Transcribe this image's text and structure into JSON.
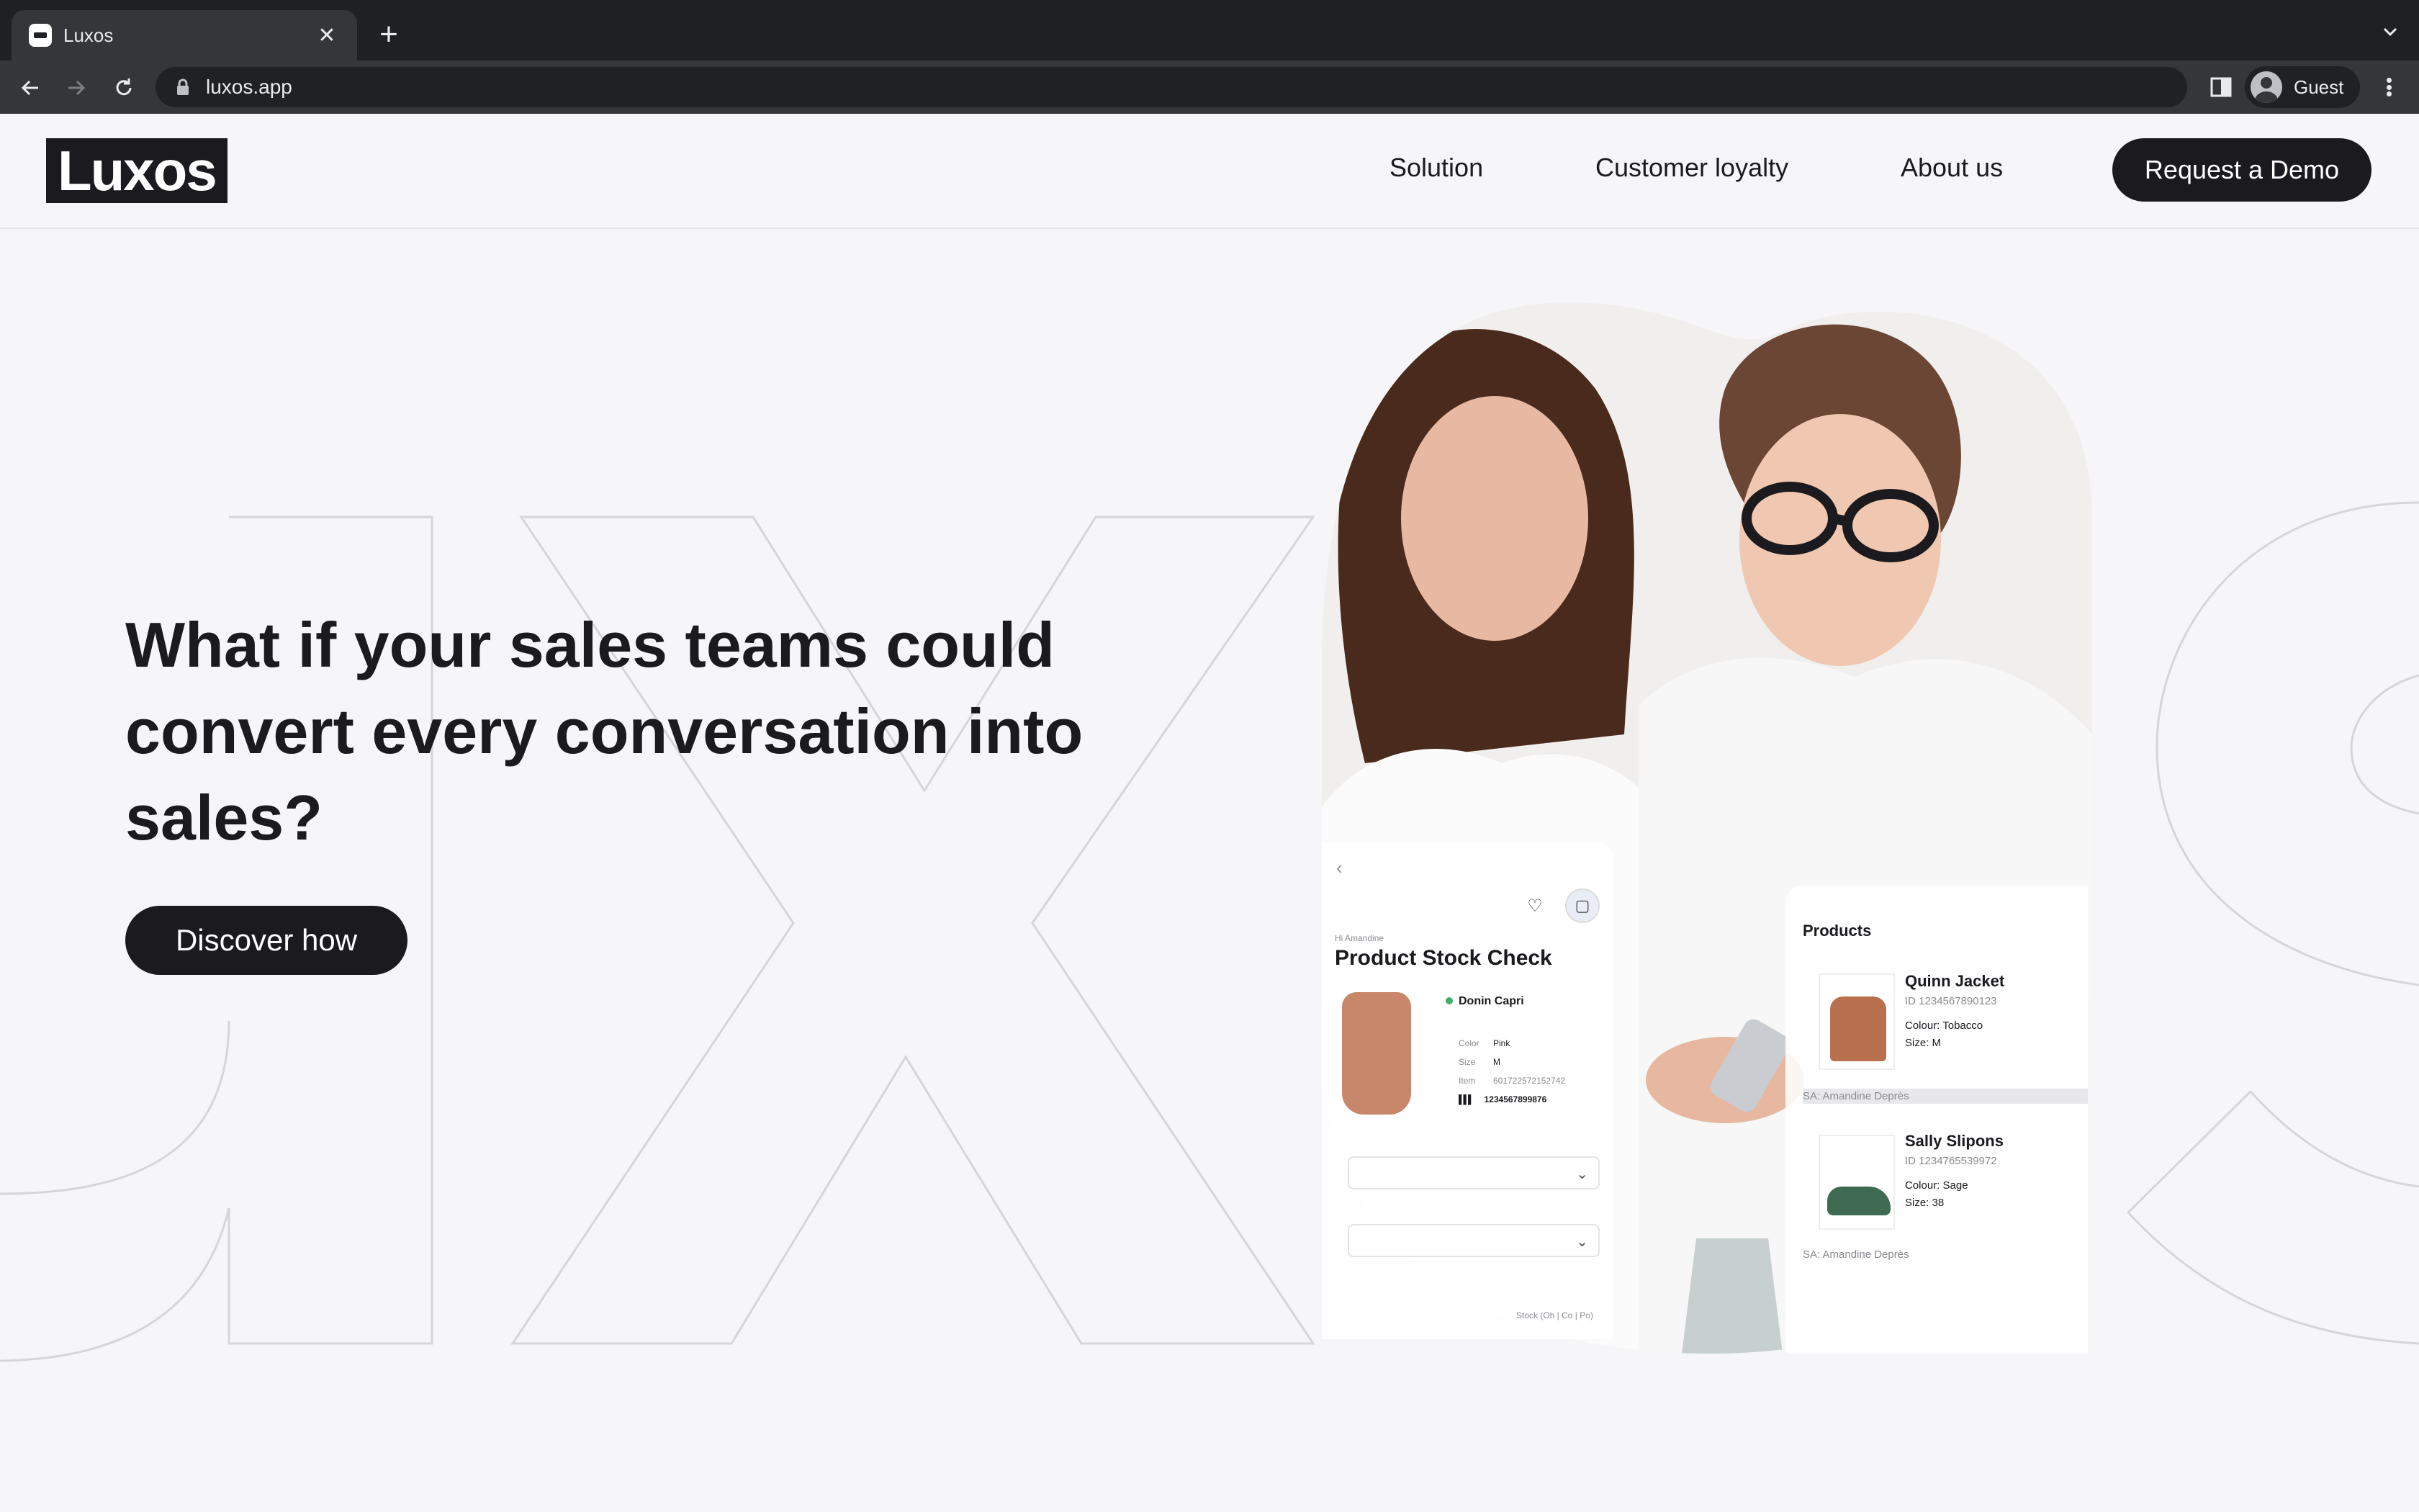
{
  "browser": {
    "tab_title": "Luxos",
    "new_tab_symbol": "+",
    "close_symbol": "✕",
    "url": "luxos.app",
    "profile_name": "Guest"
  },
  "site": {
    "logo": "Luxos",
    "nav": [
      "Solution",
      "Customer loyalty",
      "About us"
    ],
    "cta": "Request a Demo"
  },
  "hero": {
    "headline_lines": [
      "What if your sales teams could",
      "convert every conversation into",
      "sales?"
    ],
    "button": "Discover how"
  },
  "stock_card": {
    "greeting": "Hi Amandine",
    "title": "Product Stock Check",
    "product": "Donin Capri",
    "attributes": [
      {
        "label": "Color",
        "value": "Pink"
      },
      {
        "label": "Size",
        "value": "M"
      },
      {
        "label": "Item",
        "value": "601722572152742"
      }
    ],
    "barcode": "1234567899876",
    "footer": "Stock (Oh | Co | Po)"
  },
  "products_card": {
    "heading": "Products",
    "items": [
      {
        "name": "Quinn Jacket",
        "id": "ID 1234567890123",
        "colour": "Colour: Tobacco",
        "size": "Size: M",
        "sa": "SA: Amandine Deprès"
      },
      {
        "name": "Sally Slipons",
        "id": "ID 1234765539972",
        "colour": "Colour: Sage",
        "size": "Size: 38",
        "sa": "SA: Amandine Deprès"
      }
    ]
  },
  "colors": {
    "page_bg": "#f6f6f8",
    "text": "#1b1b1f",
    "chrome_dark": "#1f2023",
    "chrome_toolbar": "#35363a"
  }
}
